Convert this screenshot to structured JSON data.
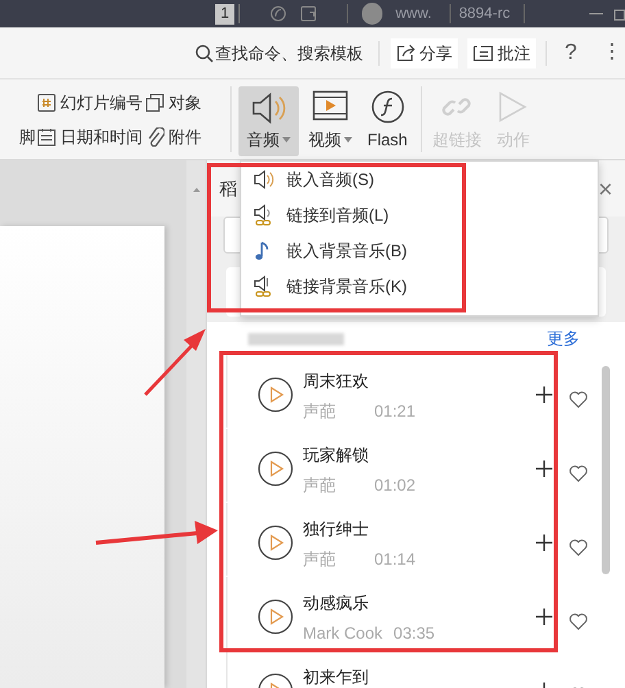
{
  "title_bar": {
    "page_badge": "1",
    "user_name": "www.",
    "user_suffix": "8894-rc"
  },
  "command_bar": {
    "search": "查找命令、搜索模板",
    "buttons": [
      {
        "label": "分享",
        "kind": "share"
      },
      {
        "label": "批注",
        "kind": "comment"
      }
    ],
    "help": "?",
    "more": "⋮"
  },
  "ribbon": {
    "small_items": [
      {
        "label": "幻灯片编号",
        "kind": "number"
      },
      {
        "label": "对象",
        "kind": "object"
      },
      {
        "label": "脚"
      },
      {
        "label": "日期和时间",
        "kind": "calendar"
      },
      {
        "label": "附件",
        "kind": "clip"
      }
    ],
    "large_items": [
      {
        "label": "音频",
        "kind": "audio",
        "selected": true,
        "disabled": false,
        "dropdown": true
      },
      {
        "label": "视频",
        "kind": "video",
        "selected": false,
        "disabled": false,
        "dropdown": true
      },
      {
        "label": "Flash",
        "kind": "flash",
        "selected": false,
        "disabled": false,
        "dropdown": false
      },
      {
        "label": "超链接",
        "kind": "link",
        "selected": false,
        "disabled": true,
        "dropdown": false
      },
      {
        "label": "动作",
        "kind": "action",
        "selected": false,
        "disabled": true,
        "dropdown": false
      }
    ]
  },
  "audio_menu": [
    {
      "label": "嵌入音频(S)",
      "kind": "audio"
    },
    {
      "label": "链接到音频(L)",
      "kind": "linked-audio"
    },
    {
      "label": "嵌入背景音乐(B)",
      "kind": "music"
    },
    {
      "label": "链接背景音乐(K)",
      "kind": "linked-music"
    }
  ],
  "side_panel": {
    "title": "稻",
    "close": "×",
    "more_link": "更多",
    "songs": [
      {
        "title": "周末狂欢",
        "artist": "声葩",
        "duration": "01:21"
      },
      {
        "title": "玩家解锁",
        "artist": "声葩",
        "duration": "01:02"
      },
      {
        "title": "独行绅士",
        "artist": "声葩",
        "duration": "01:14"
      },
      {
        "title": "动感疯乐",
        "artist": "Mark Cook",
        "duration": "03:35"
      },
      {
        "title": "初来乍到"
      }
    ]
  },
  "annotations": [
    {
      "kind": "frame"
    },
    {
      "kind": "frame"
    },
    {
      "kind": "arrow"
    },
    {
      "kind": "arrow"
    }
  ]
}
